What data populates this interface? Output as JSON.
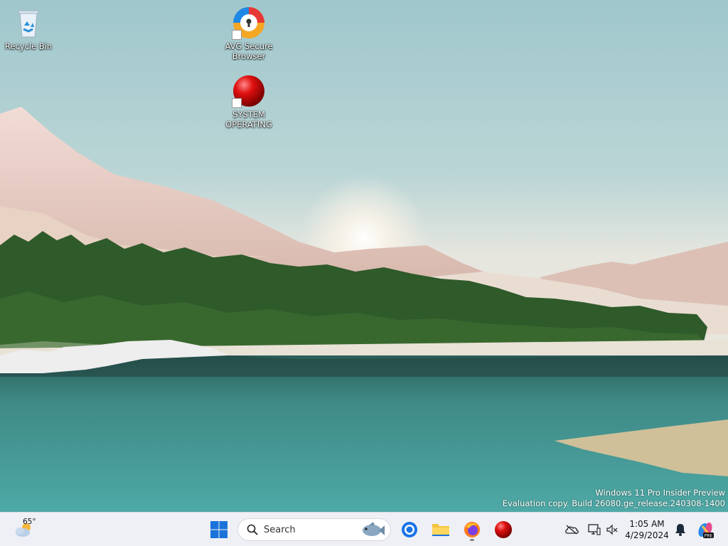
{
  "desktop": {
    "icons": [
      {
        "label": "Recycle Bin",
        "icon": "recycle-bin-icon"
      },
      {
        "label": "AVG Secure Browser",
        "icon": "avg-browser-icon"
      },
      {
        "label": "SYSTEM OPERATING",
        "icon": "red-sphere-icon"
      }
    ],
    "watermark": {
      "line1": "Windows 11 Pro Insider Preview",
      "line2": "Evaluation copy. Build 26080.ge_release.240308-1400"
    }
  },
  "taskbar": {
    "weather": {
      "temp": "65°",
      "icon": "partly-cloudy-icon"
    },
    "start_icon": "windows-start-icon",
    "search": {
      "placeholder": "Search"
    },
    "pinned": [
      {
        "name": "chrome",
        "icon": "chrome-icon"
      },
      {
        "name": "file-explorer",
        "icon": "folder-icon"
      },
      {
        "name": "firefox",
        "icon": "firefox-icon",
        "running": true
      },
      {
        "name": "system-operating",
        "icon": "red-sphere-icon"
      }
    ],
    "tray": {
      "time": "1:05 AM",
      "date": "4/29/2024",
      "icons": [
        "onedrive-offline-icon",
        "network-icon",
        "volume-muted-icon",
        "notification-bell-icon",
        "copilot-icon"
      ]
    }
  },
  "colors": {
    "accent": "#0067c0",
    "taskbar_bg": "#eef0f5",
    "sky": "#a9ccd0",
    "water": "#3e8f8c",
    "forest": "#2f5a2a"
  }
}
